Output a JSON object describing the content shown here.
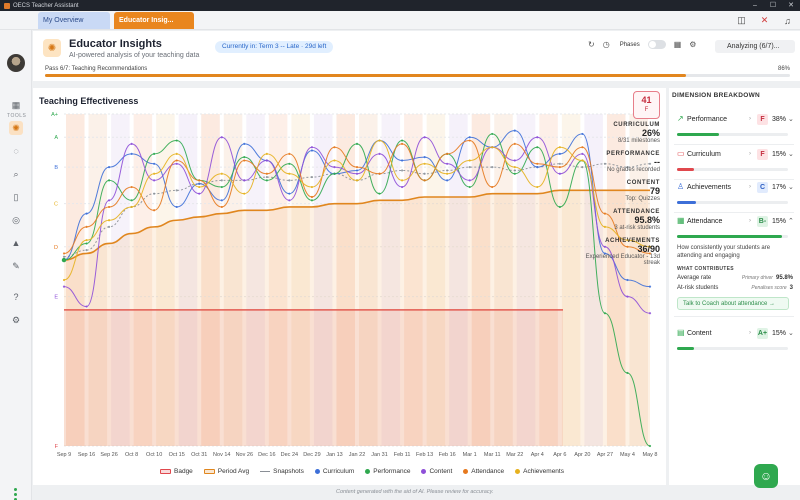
{
  "window": {
    "app_title": "OECS Teacher Assistant",
    "tabs": [
      {
        "label": "My Overview"
      },
      {
        "label": "Educator Insig..."
      }
    ]
  },
  "sidebar": {
    "section_label": "TOOLS",
    "icons": [
      "grid-icon",
      "lightbulb-icon",
      "chat-icon",
      "search-icon",
      "book-icon",
      "target-icon",
      "flask-icon",
      "pen-icon",
      "help-icon",
      "settings-icon"
    ]
  },
  "header": {
    "title": "Educator Insights",
    "subtitle": "AI-powered analysis of your teaching data",
    "term_badge": "Currently in: Term 3 -- Late  ·  29d left",
    "phases_label": "Phases",
    "analyzing_label": "Analyzing (6/7)...",
    "pass_label": "Pass 6/7: Teaching Recommendations",
    "pass_percent": "86%",
    "pass_progress": 0.86
  },
  "chart_card": {
    "title": "Teaching Effectiveness",
    "grade_value": "41",
    "grade_letter": "F",
    "overlay": [
      {
        "key": "CURRICULUM",
        "value": "26%",
        "sub": "8/31 milestones"
      },
      {
        "key": "PERFORMANCE",
        "value": "--",
        "sub": "No grades recorded"
      },
      {
        "key": "CONTENT",
        "value": "79",
        "sub": "Top: Quizzes"
      },
      {
        "key": "ATTENDANCE",
        "value": "95.8%",
        "sub": "3 at-risk students"
      },
      {
        "key": "ACHIEVEMENTS",
        "value": "36/90",
        "sub": "Experienced Educator - 13d streak"
      }
    ],
    "legend": [
      {
        "label": "Badge",
        "color": "#e0484d"
      },
      {
        "label": "Period Avg",
        "color": "#e0861e"
      },
      {
        "label": "Snapshots",
        "color": "#8a8f96"
      },
      {
        "label": "Curriculum",
        "color": "#3d6fd8"
      },
      {
        "label": "Performance",
        "color": "#2fa84f"
      },
      {
        "label": "Content",
        "color": "#8e4fd8"
      },
      {
        "label": "Attendance",
        "color": "#e6791e"
      },
      {
        "label": "Achievements",
        "color": "#e6b11e"
      }
    ]
  },
  "chart_data": {
    "type": "line",
    "title": "Teaching Effectiveness",
    "y_ticks": [
      "A+",
      "A",
      "B",
      "C",
      "D",
      "E",
      "F"
    ],
    "y_scale": [
      0,
      100
    ],
    "x": [
      "Sep 9",
      "Sep 16",
      "Sep 26",
      "Oct 8",
      "Oct 10",
      "Oct 15",
      "Oct 31",
      "Nov 14",
      "Nov 26",
      "Dec 16",
      "Dec 24",
      "Dec 29",
      "Jan 13",
      "Jan 22",
      "Jan 31",
      "Feb 11",
      "Feb 13",
      "Feb 16",
      "Mar 1",
      "Mar 11",
      "Mar 22",
      "Apr 4",
      "Apr 6",
      "Apr 20",
      "Apr 27",
      "May 4",
      "May 8"
    ],
    "badge": 41,
    "series": [
      {
        "name": "Period Avg",
        "values": [
          56,
          58,
          61,
          64,
          66,
          68,
          69,
          70,
          71,
          71,
          72,
          72,
          73,
          73,
          74,
          74,
          75,
          75,
          75,
          76,
          76,
          76,
          77,
          77,
          77,
          77,
          77
        ]
      },
      {
        "name": "Snapshots",
        "values": [
          57,
          59,
          66,
          72,
          76,
          77,
          79,
          80,
          80,
          81,
          80,
          81,
          82,
          80,
          82,
          83,
          82,
          83,
          84,
          84,
          83,
          84,
          85,
          84,
          85,
          84,
          85
        ]
      },
      {
        "name": "Curriculum",
        "values": [
          56,
          70,
          84,
          88,
          85,
          72,
          79,
          74,
          91,
          86,
          76,
          89,
          82,
          83,
          92,
          86,
          87,
          80,
          93,
          90,
          95,
          84,
          88,
          94,
          58,
          50,
          48
        ]
      },
      {
        "name": "Performance",
        "values": [
          56,
          61,
          80,
          74,
          88,
          92,
          80,
          78,
          87,
          80,
          85,
          74,
          82,
          91,
          76,
          92,
          80,
          88,
          78,
          94,
          82,
          90,
          72,
          86,
          40,
          22,
          0
        ]
      },
      {
        "name": "Content",
        "values": [
          48,
          42,
          74,
          91,
          80,
          85,
          76,
          93,
          80,
          86,
          74,
          90,
          84,
          82,
          88,
          78,
          93,
          85,
          80,
          90,
          86,
          93,
          82,
          88,
          60,
          45,
          40
        ]
      },
      {
        "name": "Attendance",
        "values": [
          58,
          66,
          72,
          78,
          71,
          86,
          80,
          72,
          86,
          82,
          88,
          75,
          90,
          84,
          82,
          91,
          80,
          88,
          92,
          78,
          91,
          85,
          84,
          90,
          70,
          60,
          58
        ]
      },
      {
        "name": "Achievements",
        "values": [
          50,
          62,
          68,
          72,
          82,
          88,
          78,
          82,
          76,
          88,
          82,
          78,
          86,
          80,
          92,
          80,
          85,
          82,
          86,
          90,
          84,
          78,
          90,
          86,
          66,
          62,
          60
        ]
      }
    ]
  },
  "panel": {
    "title": "DIMENSION BREAKDOWN",
    "dimensions": [
      {
        "name": "Performance",
        "grade": "F",
        "percent": "38%",
        "value": 0.38,
        "color": "#2fa84f",
        "grade_bg": "#fde2e4",
        "grade_fg": "#c42c3e",
        "icon": "trend-icon",
        "glyph": "↗"
      },
      {
        "name": "Curriculum",
        "grade": "F",
        "percent": "15%",
        "value": 0.15,
        "color": "#e0484d",
        "grade_bg": "#fde2e4",
        "grade_fg": "#c42c3e",
        "icon": "book-icon",
        "glyph": "▭"
      },
      {
        "name": "Achievements",
        "grade": "C",
        "percent": "17%",
        "value": 0.17,
        "color": "#3d6fd8",
        "grade_bg": "#e1ebfd",
        "grade_fg": "#2e5fc4",
        "icon": "trophy-icon",
        "glyph": "♙"
      },
      {
        "name": "Attendance",
        "grade": "B-",
        "percent": "15%",
        "value": 0.95,
        "color": "#2fa84f",
        "grade_bg": "#dff3e5",
        "grade_fg": "#2f8f4c",
        "icon": "calendar-icon",
        "glyph": "▦"
      },
      {
        "name": "Content",
        "grade": "A+",
        "percent": "15%",
        "value": 0.15,
        "color": "#2fa84f",
        "grade_bg": "#dff3e5",
        "grade_fg": "#2f8f4c",
        "icon": "file-icon",
        "glyph": "▤"
      }
    ],
    "attendance_desc": "How consistently your students are attending and engaging",
    "contributes_label": "WHAT CONTRIBUTES",
    "contributes": [
      {
        "label": "Average rate",
        "tag": "Primary driver",
        "value": "95.8%"
      },
      {
        "label": "At-risk students",
        "tag": "Penalises score",
        "value": "3"
      }
    ],
    "coach_label": "Talk to Coach about attendance →"
  },
  "footer": "Content generated with the aid of AI. Please review for accuracy."
}
